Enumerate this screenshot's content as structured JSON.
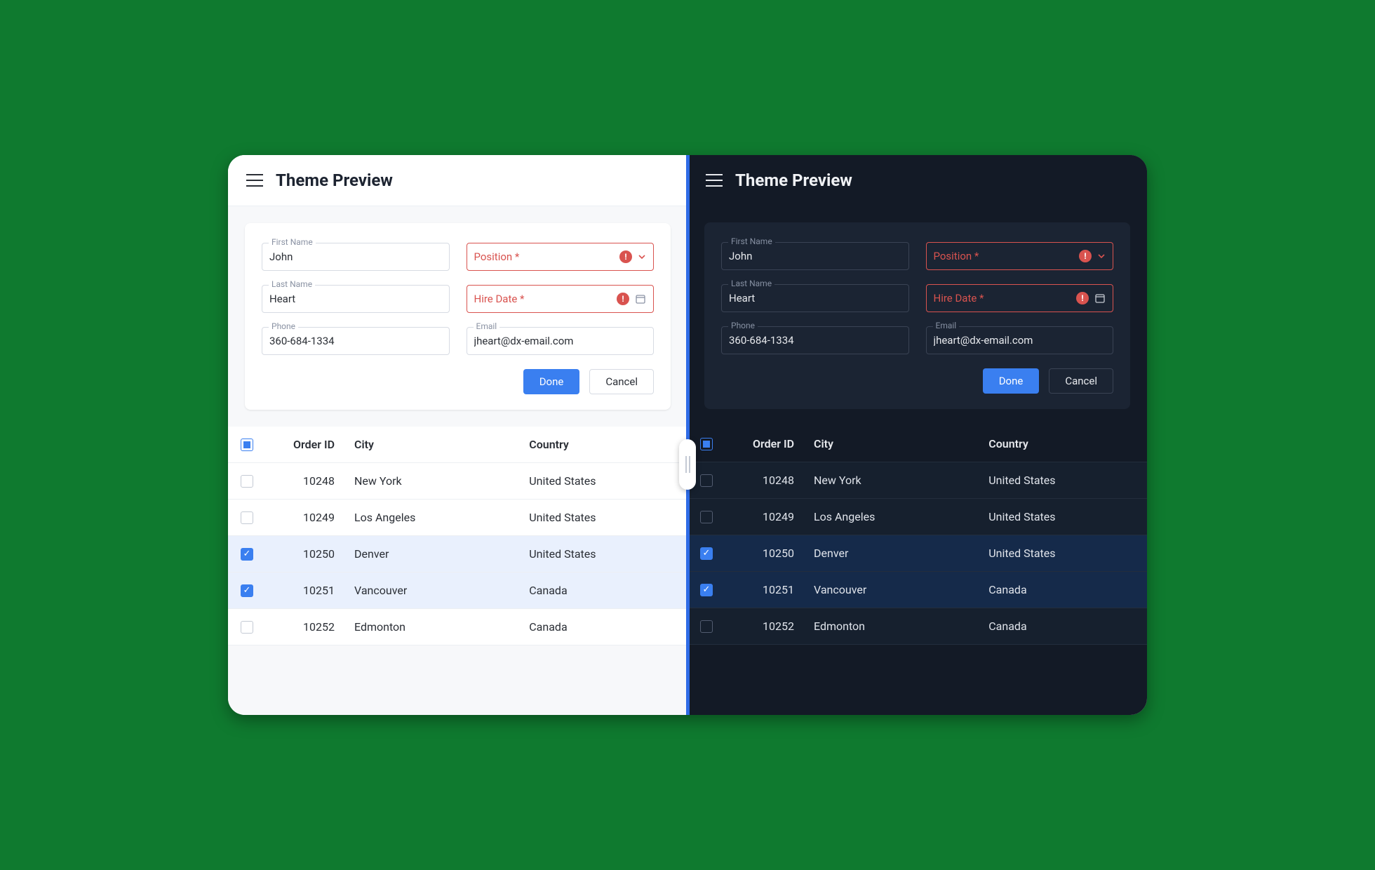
{
  "title": "Theme Preview",
  "form": {
    "first_name": {
      "label": "First Name",
      "value": "John"
    },
    "last_name": {
      "label": "Last Name",
      "value": "Heart"
    },
    "phone": {
      "label": "Phone",
      "value": "360-684-1334"
    },
    "position": {
      "label": "Position *",
      "value": ""
    },
    "hire_date": {
      "label": "Hire Date *",
      "value": ""
    },
    "email": {
      "label": "Email",
      "value": "jheart@dx-email.com"
    }
  },
  "buttons": {
    "done": "Done",
    "cancel": "Cancel"
  },
  "table": {
    "headers": {
      "order_id": "Order ID",
      "city": "City",
      "country": "Country"
    },
    "rows": [
      {
        "id": "10248",
        "city": "New York",
        "country": "United States",
        "selected": false
      },
      {
        "id": "10249",
        "city": "Los Angeles",
        "country": "United States",
        "selected": false
      },
      {
        "id": "10250",
        "city": "Denver",
        "country": "United States",
        "selected": true
      },
      {
        "id": "10251",
        "city": "Vancouver",
        "country": "Canada",
        "selected": true
      },
      {
        "id": "10252",
        "city": "Edmonton",
        "country": "Canada",
        "selected": false
      }
    ]
  }
}
